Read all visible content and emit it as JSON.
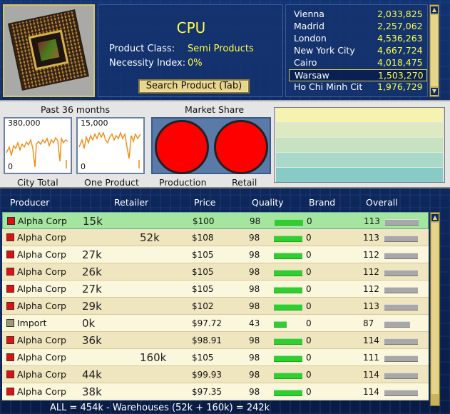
{
  "product": {
    "name": "CPU",
    "class_label": "Product Class:",
    "class_value": "Semi Products",
    "necessity_label": "Necessity Index:",
    "necessity_value": "0%",
    "search_button": "Search Product (Tab)"
  },
  "cities": [
    {
      "name": "Vienna",
      "value": "2,033,825"
    },
    {
      "name": "Madrid",
      "value": "2,257,062"
    },
    {
      "name": "London",
      "value": "4,536,263"
    },
    {
      "name": "New York City",
      "value": "4,667,724"
    },
    {
      "name": "Cairo",
      "value": "4,018,475"
    },
    {
      "name": "Warsaw",
      "value": "1,503,270",
      "selected": true
    },
    {
      "name": "Ho Chi Minh Cit",
      "value": "1,976,729"
    }
  ],
  "charts": {
    "past_title": "Past 36  months",
    "share_title": "Market Share",
    "city_total": {
      "top": "380,000",
      "bottom": "0",
      "label": "City Total"
    },
    "one_product": {
      "top": "15,000",
      "bottom": "0",
      "label": "One Product"
    },
    "production_label": "Production",
    "retail_label": "Retail"
  },
  "table": {
    "headers": {
      "producer": "Producer",
      "retailer": "Retailer",
      "price": "Price",
      "quality": "Quality",
      "brand": "Brand",
      "overall": "Overall"
    },
    "rows": [
      {
        "producer": "Alpha Corp",
        "color": "#dd1111",
        "retail": "15k",
        "ret_col": 1,
        "price": "$100",
        "quality": "98",
        "qfill": 1.0,
        "brand": "0",
        "overall": "113",
        "ofill": 1.0,
        "selected": true
      },
      {
        "producer": "Alpha Corp",
        "color": "#dd1111",
        "retail": "52k",
        "ret_col": 2,
        "price": "$108",
        "quality": "98",
        "qfill": 1.0,
        "brand": "0",
        "overall": "113",
        "ofill": 1.0
      },
      {
        "producer": "Alpha Corp",
        "color": "#dd1111",
        "retail": "27k",
        "ret_col": 1,
        "price": "$105",
        "quality": "98",
        "qfill": 1.0,
        "brand": "0",
        "overall": "112",
        "ofill": 1.0
      },
      {
        "producer": "Alpha Corp",
        "color": "#dd1111",
        "retail": "26k",
        "ret_col": 1,
        "price": "$105",
        "quality": "98",
        "qfill": 1.0,
        "brand": "0",
        "overall": "112",
        "ofill": 1.0
      },
      {
        "producer": "Alpha Corp",
        "color": "#dd1111",
        "retail": "27k",
        "ret_col": 1,
        "price": "$105",
        "quality": "98",
        "qfill": 1.0,
        "brand": "0",
        "overall": "112",
        "ofill": 1.0
      },
      {
        "producer": "Alpha Corp",
        "color": "#dd1111",
        "retail": "29k",
        "ret_col": 1,
        "price": "$102",
        "quality": "98",
        "qfill": 1.0,
        "brand": "0",
        "overall": "113",
        "ofill": 1.0
      },
      {
        "producer": "Import",
        "color": "#9a9a78",
        "retail": "0k",
        "ret_col": 1,
        "price": "$97.72",
        "quality": "43",
        "qfill": 0.44,
        "brand": "0",
        "overall": "87",
        "ofill": 0.77
      },
      {
        "producer": "Alpha Corp",
        "color": "#dd1111",
        "retail": "36k",
        "ret_col": 1,
        "price": "$98.91",
        "quality": "98",
        "qfill": 1.0,
        "brand": "0",
        "overall": "114",
        "ofill": 1.0
      },
      {
        "producer": "Alpha Corp",
        "color": "#dd1111",
        "retail": "160k",
        "ret_col": 2,
        "price": "$105",
        "quality": "98",
        "qfill": 1.0,
        "brand": "0",
        "overall": "111",
        "ofill": 1.0
      },
      {
        "producer": "Alpha Corp",
        "color": "#dd1111",
        "retail": "44k",
        "ret_col": 1,
        "price": "$99.93",
        "quality": "98",
        "qfill": 1.0,
        "brand": "0",
        "overall": "114",
        "ofill": 1.0
      },
      {
        "producer": "Alpha Corp",
        "color": "#dd1111",
        "retail": "38k",
        "ret_col": 1,
        "price": "$97.35",
        "quality": "98",
        "qfill": 1.0,
        "brand": "0",
        "overall": "114",
        "ofill": 1.0
      }
    ]
  },
  "footer": "ALL = 454k - Warehouses  (52k + 160k) = 242k"
}
